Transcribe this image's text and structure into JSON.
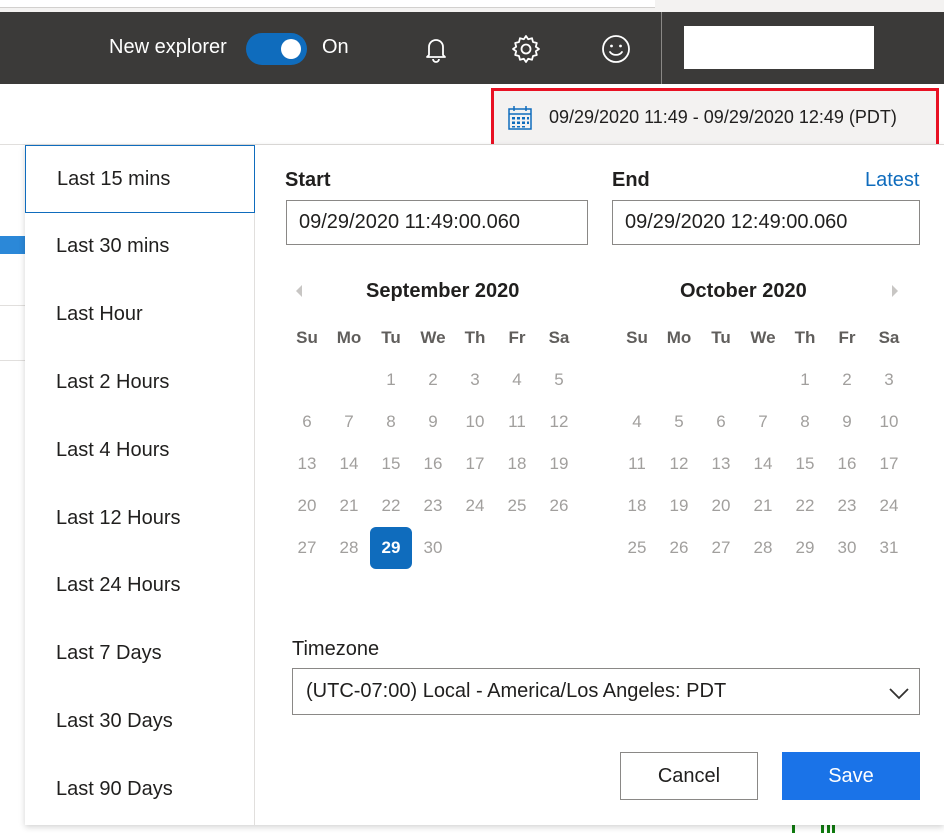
{
  "header": {
    "explorer_label": "New explorer",
    "toggle_state": "On",
    "icons": [
      "bell-icon",
      "gear-icon",
      "smiley-icon"
    ],
    "colors": {
      "background": "#3b3a39",
      "toggle": "#0f6cbd"
    }
  },
  "range_selector": {
    "icon": "calendar-icon",
    "label": "09/29/2020 11:49 - 09/29/2020 12:49 (PDT)",
    "highlight_color": "#e81123"
  },
  "quick_ranges": [
    "Last 15 mins",
    "Last 30 mins",
    "Last Hour",
    "Last 2 Hours",
    "Last 4 Hours",
    "Last 12 Hours",
    "Last 24 Hours",
    "Last 7 Days",
    "Last 30 Days",
    "Last 90 Days"
  ],
  "quick_ranges_selected": "Last 15 mins",
  "start": {
    "label": "Start",
    "value": "09/29/2020 11:49:00.060"
  },
  "end": {
    "label": "End",
    "value": "09/29/2020 12:49:00.060",
    "latest_link": "Latest"
  },
  "calendar": {
    "weekdays": [
      "Su",
      "Mo",
      "Tu",
      "We",
      "Th",
      "Fr",
      "Sa"
    ],
    "selected_day": "29",
    "selected_color": "#0f6cbd",
    "months": [
      {
        "title": "September  2020",
        "weeks": [
          [
            "",
            "",
            "1",
            "2",
            "3",
            "4",
            "5"
          ],
          [
            "6",
            "7",
            "8",
            "9",
            "10",
            "11",
            "12"
          ],
          [
            "13",
            "14",
            "15",
            "16",
            "17",
            "18",
            "19"
          ],
          [
            "20",
            "21",
            "22",
            "23",
            "24",
            "25",
            "26"
          ],
          [
            "27",
            "28",
            "29",
            "30",
            "",
            "",
            ""
          ]
        ]
      },
      {
        "title": "October  2020",
        "weeks": [
          [
            "",
            "",
            "",
            "",
            "1",
            "2",
            "3"
          ],
          [
            "4",
            "5",
            "6",
            "7",
            "8",
            "9",
            "10"
          ],
          [
            "11",
            "12",
            "13",
            "14",
            "15",
            "16",
            "17"
          ],
          [
            "18",
            "19",
            "20",
            "21",
            "22",
            "23",
            "24"
          ],
          [
            "25",
            "26",
            "27",
            "28",
            "29",
            "30",
            "31"
          ]
        ]
      }
    ]
  },
  "timezone": {
    "label": "Timezone",
    "value": "(UTC-07:00) Local - America/Los Angeles: PDT"
  },
  "buttons": {
    "cancel": "Cancel",
    "save": "Save",
    "save_color": "#1a73e8"
  }
}
